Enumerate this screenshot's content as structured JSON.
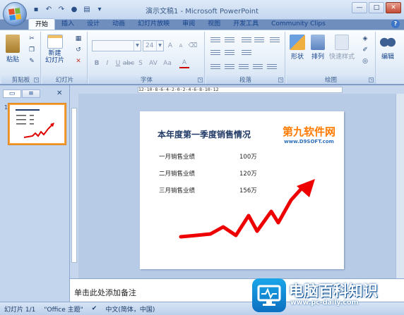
{
  "window": {
    "title": "演示文稿1 - Microsoft PowerPoint"
  },
  "tabs": [
    {
      "label": "开始",
      "active": true
    },
    {
      "label": "插入"
    },
    {
      "label": "设计"
    },
    {
      "label": "动画"
    },
    {
      "label": "幻灯片放映"
    },
    {
      "label": "审阅"
    },
    {
      "label": "视图"
    },
    {
      "label": "开发工具"
    },
    {
      "label": "Community Clips"
    }
  ],
  "ribbon": {
    "groups": {
      "clipboard": "剪贴板",
      "slides": "幻灯片",
      "font": "字体",
      "paragraph": "段落",
      "drawing": "绘图"
    },
    "buttons": {
      "paste": "粘贴",
      "new_slide": "新建\n幻灯片",
      "shapes": "形状",
      "arrange": "排列",
      "quick_styles": "快速样式",
      "edit": "编辑"
    },
    "font_size": "24",
    "font_name": ""
  },
  "panel": {
    "slide_number": "1"
  },
  "ruler": {
    "horizontal": "12·10·8·6·4·2·0·2·4·6·8·10·12"
  },
  "slide": {
    "title": "本年度第一季度销售情况",
    "rows": [
      {
        "label": "一月销售业绩",
        "value": "100万"
      },
      {
        "label": "二月销售业绩",
        "value": "120万"
      },
      {
        "label": "三月销售业绩",
        "value": "156万"
      }
    ],
    "watermark": {
      "name": "第九软件网",
      "url": "www.D9SOFT.com"
    }
  },
  "notes": {
    "placeholder": "单击此处添加备注"
  },
  "status": {
    "slide": "幻灯片 1/1",
    "theme": "\"Office 主题\"",
    "language": "中文(简体，中国)"
  },
  "brand": {
    "name": "电脑百科知识",
    "url": "www.pc-daily.com"
  },
  "colors": {
    "accent": "#ff0000",
    "ribbon_text": "#15428b",
    "title": "#1f3864"
  }
}
